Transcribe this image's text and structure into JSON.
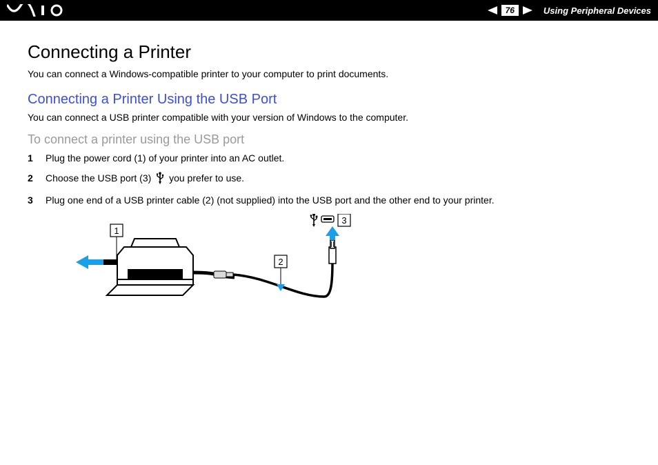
{
  "header": {
    "page_number": "76",
    "section": "Using Peripheral Devices"
  },
  "content": {
    "title": "Connecting a Printer",
    "intro": "You can connect a Windows-compatible printer to your computer to print documents.",
    "subtitle": "Connecting a Printer Using the USB Port",
    "subintro": "You can connect a USB printer compatible with your version of Windows to the computer.",
    "procedure_title": "To connect a printer using the USB port",
    "steps": {
      "s1_num": "1",
      "s1_text": "Plug the power cord (1) of your printer into an AC outlet.",
      "s2_num": "2",
      "s2_text_a": "Choose the USB port (3)",
      "s2_text_b": " you prefer to use.",
      "s3_num": "3",
      "s3_text": "Plug one end of a USB printer cable (2) (not supplied) into the USB port and the other end to your printer."
    },
    "diagram_labels": {
      "l1": "1",
      "l2": "2",
      "l3": "3"
    }
  }
}
